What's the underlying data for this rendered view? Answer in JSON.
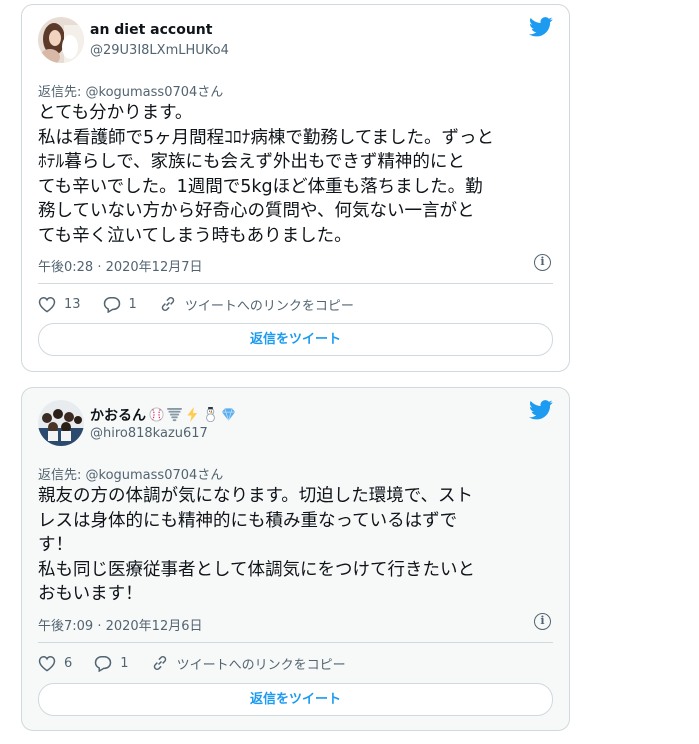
{
  "tweets": [
    {
      "author_name": "an diet account",
      "author_handle": "@29U3I8LXmLHUKo4",
      "reply_to": "返信先: @kogumass0704さん",
      "text": "とても分かります。\n私は看護師で5ヶ月間程ｺﾛﾅ病棟で勤務してました。ずっと\nﾎﾃﾙ暮らしで、家族にも会えず外出もできず精神的にと\nても辛いでした。1週間で5kgほど体重も落ちました。勤\n務していない方から好奇心の質問や、何気ない一言がと\nても辛く泣いてしまう時もありました。",
      "timestamp": "午後0:28 · 2020年12月7日",
      "likes": "13",
      "replies": "1",
      "copy_link": "ツイートへのリンクをコピー",
      "reply_button": "返信をツイート"
    },
    {
      "author_name": "かおるん",
      "author_handle": "@hiro818kazu617",
      "reply_to": "返信先: @kogumass0704さん",
      "text": "親友の方の体調が気になります。切迫した環境で、スト\nレスは身体的にも精神的にも積み重なっているはずで\nす！\n私も同じ医療従事者として体調気にをつけて行きたいと\nおもいます！",
      "timestamp": "午後7:09 · 2020年12月6日",
      "likes": "6",
      "replies": "1",
      "copy_link": "ツイートへのリンクをコピー",
      "reply_button": "返信をツイート"
    }
  ],
  "icons": {
    "brand": "twitter-bird-icon",
    "like": "heart-icon",
    "reply": "reply-bubble-icon",
    "link": "link-icon",
    "info": "info-icon"
  },
  "colors": {
    "brand_blue": "#1d9bf0",
    "text_primary": "#0f1419",
    "text_secondary": "#536471",
    "border": "#cfd9de"
  }
}
